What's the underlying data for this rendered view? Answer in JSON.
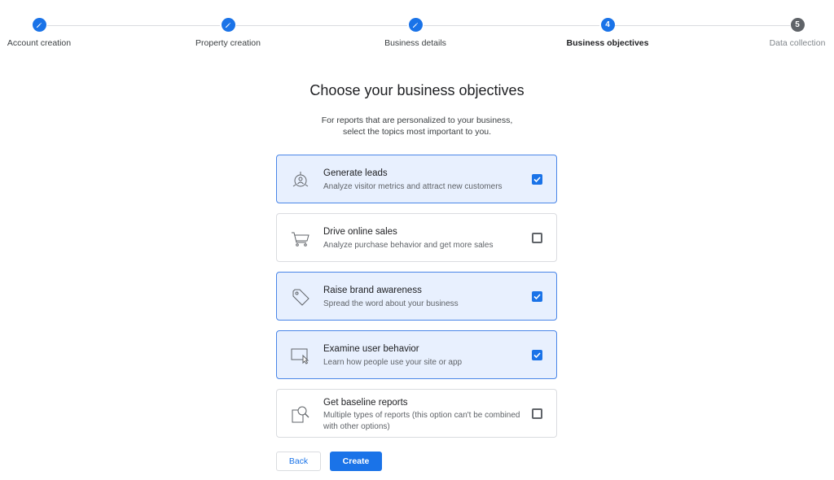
{
  "stepper": {
    "steps": [
      {
        "label": "Account creation",
        "state": "done",
        "number": ""
      },
      {
        "label": "Property creation",
        "state": "done",
        "number": ""
      },
      {
        "label": "Business details",
        "state": "done",
        "number": ""
      },
      {
        "label": "Business objectives",
        "state": "active",
        "number": "4"
      },
      {
        "label": "Data collection",
        "state": "pending",
        "number": "5"
      }
    ]
  },
  "header": {
    "title": "Choose your business objectives",
    "subtitle_line1": "For reports that are personalized to your business,",
    "subtitle_line2": "select the topics most important to you."
  },
  "objectives": [
    {
      "title": "Generate leads",
      "description": "Analyze visitor metrics and attract new customers",
      "checked": true,
      "icon": "target-person-icon"
    },
    {
      "title": "Drive online sales",
      "description": "Analyze purchase behavior and get more sales",
      "checked": false,
      "icon": "shopping-cart-icon"
    },
    {
      "title": "Raise brand awareness",
      "description": "Spread the word about your business",
      "checked": true,
      "icon": "tag-icon"
    },
    {
      "title": "Examine user behavior",
      "description": "Learn how people use your site or app",
      "checked": true,
      "icon": "screen-cursor-icon"
    },
    {
      "title": "Get baseline reports",
      "description": "Multiple types of reports (this option can't be combined with other options)",
      "checked": false,
      "icon": "magnifier-document-icon"
    }
  ],
  "actions": {
    "back_label": "Back",
    "create_label": "Create"
  },
  "colors": {
    "accent": "#1a73e8",
    "checked_card_bg": "#e8f0fe",
    "pending_step": "#5f6368"
  }
}
